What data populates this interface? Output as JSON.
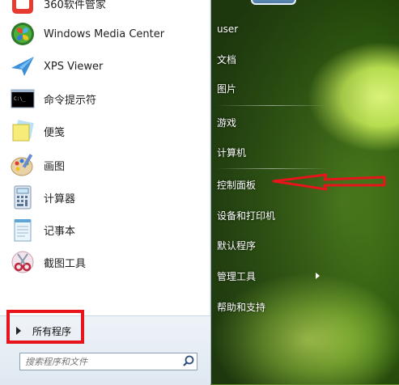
{
  "left_menu": {
    "items": [
      {
        "label": "360软件管家",
        "icon": "software-manager-icon"
      },
      {
        "label": "Windows Media Center",
        "icon": "media-center-icon"
      },
      {
        "label": "XPS Viewer",
        "icon": "xps-viewer-icon"
      },
      {
        "label": "命令提示符",
        "icon": "command-prompt-icon"
      },
      {
        "label": "便笺",
        "icon": "sticky-notes-icon"
      },
      {
        "label": "画图",
        "icon": "paint-icon"
      },
      {
        "label": "计算器",
        "icon": "calculator-icon"
      },
      {
        "label": "记事本",
        "icon": "notepad-icon"
      },
      {
        "label": "截图工具",
        "icon": "snipping-tool-icon"
      }
    ],
    "all_programs": "所有程序",
    "search_placeholder": "搜索程序和文件"
  },
  "right_menu": {
    "items": [
      {
        "label": "user"
      },
      {
        "label": "文档"
      },
      {
        "label": "图片"
      },
      {
        "label": "游戏"
      },
      {
        "label": "计算机"
      },
      {
        "label": "控制面板"
      },
      {
        "label": "设备和打印机"
      },
      {
        "label": "默认程序"
      },
      {
        "label": "管理工具",
        "submenu": true
      },
      {
        "label": "帮助和支持"
      }
    ]
  },
  "annotation": {
    "color": "#e8141c"
  }
}
